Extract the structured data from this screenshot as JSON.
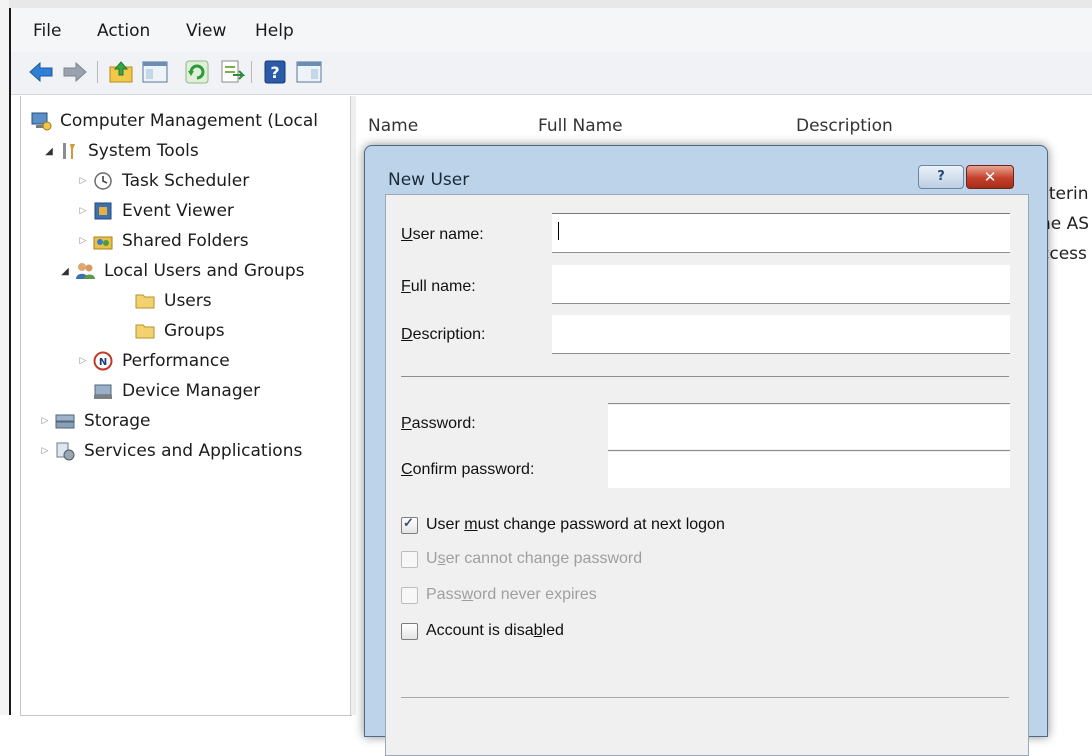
{
  "menu": {
    "file": "File",
    "action": "Action",
    "view": "View",
    "help": "Help"
  },
  "toolbar": {
    "buttons": [
      "back-icon",
      "forward-icon",
      "up-folder-icon",
      "show-hide-tree-icon",
      "refresh-icon",
      "export-list-icon",
      "help-icon",
      "action-pane-icon"
    ]
  },
  "tree": {
    "root": "Computer Management (Local",
    "system_tools": "System Tools",
    "task_scheduler": "Task Scheduler",
    "event_viewer": "Event Viewer",
    "shared_folders": "Shared Folders",
    "local_users_groups": "Local Users and Groups",
    "users": "Users",
    "groups": "Groups",
    "performance": "Performance",
    "device_manager": "Device Manager",
    "storage": "Storage",
    "services_apps": "Services and Applications"
  },
  "list": {
    "columns": [
      "Name",
      "Full Name",
      "Description"
    ],
    "behind_rows": [
      "sterin",
      "ne AS",
      "ccess"
    ]
  },
  "dialog": {
    "title": "New User",
    "help_glyph": "?",
    "close_glyph": "✕",
    "user_name_label_accel": "U",
    "user_name_label_rest": "ser name:",
    "user_name_value": "",
    "full_name_label_accel": "F",
    "full_name_label_rest": "ull name:",
    "full_name_value": "",
    "description_label_accel": "D",
    "description_label_rest": "escription:",
    "description_value": "",
    "password_label_accel": "P",
    "password_label_rest": "assword:",
    "confirm_label_accel": "C",
    "confirm_label_rest": "onfirm password:",
    "checkboxes": [
      {
        "pre": "User ",
        "accel": "m",
        "post": "ust change password at next logon",
        "checked": true,
        "enabled": true
      },
      {
        "pre": "U",
        "accel": "s",
        "post": "er cannot change password",
        "checked": false,
        "enabled": false
      },
      {
        "pre": "Pass",
        "accel": "w",
        "post": "ord never expires",
        "checked": false,
        "enabled": false
      },
      {
        "pre": "Account is disa",
        "accel": "b",
        "post": "led",
        "checked": false,
        "enabled": true
      }
    ],
    "check_glyph": "✓"
  },
  "colors": {
    "dialog_frame": "#bcd3ea",
    "close_button": "#c4402b",
    "body": "#f0f0f0"
  }
}
